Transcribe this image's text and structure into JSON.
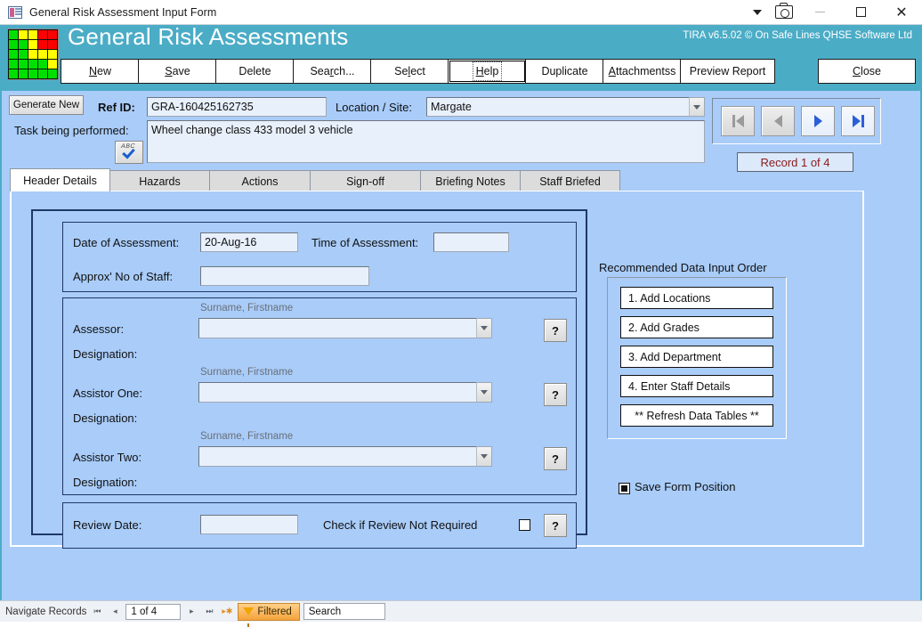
{
  "window": {
    "title": "General Risk Assessment Input Form",
    "app_icon": "form-icon",
    "controls": {
      "dropdown": "chevron-down-icon",
      "camera": "camera-icon",
      "minimize": "minimize-icon",
      "maximize": "maximize-icon",
      "close": "close-icon"
    }
  },
  "header": {
    "app_title": "General Risk Assessments",
    "vendor": "TIRA v6.5.02 © On Safe Lines QHSE Software Ltd",
    "logo_name": "risk-matrix-logo",
    "logo_colors": [
      "#00e000",
      "#ffff00",
      "#ffff00",
      "#ff0000",
      "#ff0000",
      "#00e000",
      "#00e000",
      "#ffff00",
      "#ff0000",
      "#ff0000",
      "#00e000",
      "#00e000",
      "#ffff00",
      "#ffff00",
      "#ffff00",
      "#00e000",
      "#00e000",
      "#00e000",
      "#00e000",
      "#ffff00",
      "#00e000",
      "#00e000",
      "#00e000",
      "#00e000",
      "#00e000"
    ],
    "accent": "#4bacc6"
  },
  "toolbar": {
    "buttons": [
      {
        "label": "New",
        "accel": "N",
        "focused": false
      },
      {
        "label": "Save",
        "accel": "S",
        "focused": false
      },
      {
        "label": "Delete",
        "accel": "",
        "focused": false
      },
      {
        "label": "Search...",
        "accel": "r",
        "focused": false
      },
      {
        "label": "Select",
        "accel": "l",
        "focused": false
      },
      {
        "label": "Help",
        "accel": "H",
        "focused": true
      },
      {
        "label": "Duplicate",
        "accel": "",
        "focused": false
      },
      {
        "label": "Attachmentss",
        "accel": "A",
        "focused": false
      },
      {
        "label": "Preview Report",
        "accel": "",
        "focused": false
      },
      {
        "label": "Close",
        "accel": "C",
        "focused": false
      }
    ]
  },
  "record_header": {
    "generate_new_label": "Generate New",
    "ref_id_label": "Ref ID:",
    "ref_id_value": "GRA-160425162735",
    "location_label": "Location / Site:",
    "location_value": "Margate",
    "task_label": "Task being performed:",
    "task_value": "Wheel change class 433 model 3 vehicle",
    "spellcheck_icon": "spellcheck-icon",
    "spellcheck_text": "ABC"
  },
  "navigation": {
    "first_icon": "first-record-icon",
    "prev_icon": "previous-record-icon",
    "next_icon": "next-record-icon",
    "last_icon": "last-record-icon",
    "record_counter": "Record 1 of 4",
    "counter_color": "#8b1a1a"
  },
  "tabs": [
    {
      "label": "Header Details",
      "active": true
    },
    {
      "label": "Hazards",
      "active": false
    },
    {
      "label": "Actions",
      "active": false
    },
    {
      "label": "Sign-off",
      "active": false
    },
    {
      "label": "Briefing Notes",
      "active": false
    },
    {
      "label": "Staff Briefed",
      "active": false
    }
  ],
  "form": {
    "date_label": "Date of Assessment:",
    "date_value": "20-Aug-16",
    "time_label": "Time of Assessment:",
    "time_value": "",
    "staff_label": "Approx' No of Staff:",
    "staff_value": "",
    "name_hint": "Surname, Firstname",
    "assessor_label": "Assessor:",
    "assessor_value": "",
    "assessor_designation_label": "Designation:",
    "assessor_designation_value": "",
    "assistor_one_label": "Assistor One:",
    "assistor_one_value": "",
    "assistor_one_designation_label": "Designation:",
    "assistor_one_designation_value": "",
    "assistor_two_label": "Assistor Two:",
    "assistor_two_value": "",
    "assistor_two_designation_label": "Designation:",
    "assistor_two_designation_value": "",
    "review_date_label": "Review Date:",
    "review_date_value": "",
    "review_not_required_label": "Check if Review Not Required",
    "review_not_required_checked": false,
    "help_symbol": "?"
  },
  "side_panel": {
    "title": "Recommended Data Input Order",
    "buttons": [
      {
        "label": "1. Add Locations",
        "centered": false
      },
      {
        "label": "2. Add Grades",
        "centered": false
      },
      {
        "label": "3. Add Department",
        "centered": false
      },
      {
        "label": "4. Enter Staff Details",
        "centered": false
      },
      {
        "label": "** Refresh Data Tables **",
        "centered": true
      }
    ],
    "save_position_label": "Save Form Position",
    "save_position_checked": true
  },
  "status_bar": {
    "navigate_label": "Navigate Records",
    "first_icon": "first-record-icon",
    "prev_icon": "previous-record-icon",
    "counter": "1 of 4",
    "next_icon": "next-record-icon",
    "last_icon": "last-record-icon",
    "new_icon": "new-record-icon",
    "filter_label": "Filtered",
    "filter_icon": "funnel-icon",
    "search_placeholder": "Search",
    "search_value": "Search"
  }
}
